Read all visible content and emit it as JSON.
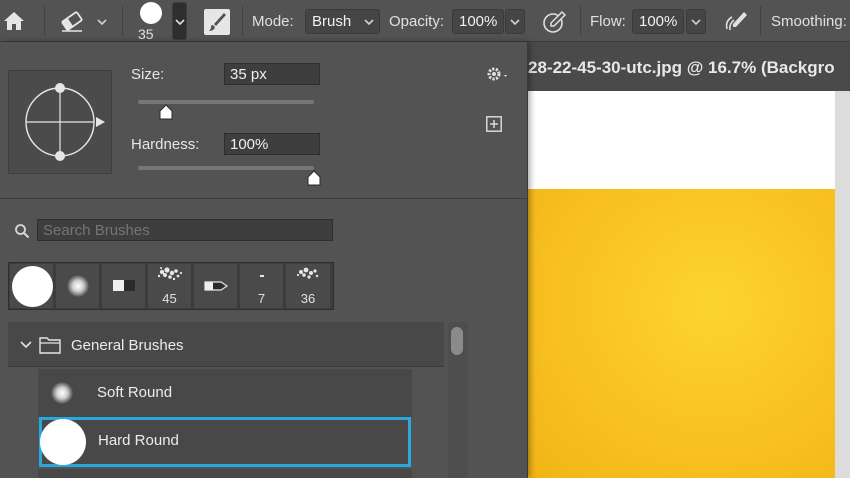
{
  "options_bar": {
    "brush_size_label": "35",
    "mode_label": "Mode:",
    "mode_value": "Brush",
    "opacity_label": "Opacity:",
    "opacity_value": "100%",
    "flow_label": "Flow:",
    "flow_value": "100%",
    "smoothing_label": "Smoothing:"
  },
  "document": {
    "tab_title": "28-22-45-30-utc.jpg @ 16.7% (Backgro"
  },
  "brush_panel": {
    "size_label": "Size:",
    "size_value": "35 px",
    "size_slider_fraction": 0.16,
    "hardness_label": "Hardness:",
    "hardness_value": "100%",
    "hardness_slider_fraction": 1.0,
    "search_placeholder": "Search Brushes",
    "presets": [
      {
        "type": "hard-round",
        "number": ""
      },
      {
        "type": "soft-round",
        "number": ""
      },
      {
        "type": "flat-brush",
        "number": ""
      },
      {
        "type": "spatter",
        "number": "45"
      },
      {
        "type": "chisel",
        "number": ""
      },
      {
        "type": "tiny",
        "number": "7"
      },
      {
        "type": "spatter",
        "number": "36"
      }
    ],
    "group_name": "General Brushes",
    "brushes": [
      {
        "name": "Soft Round"
      },
      {
        "name": "Hard Round"
      }
    ]
  },
  "colors": {
    "selection": "#29a8dc",
    "canvas_fill": "#f9c620"
  }
}
